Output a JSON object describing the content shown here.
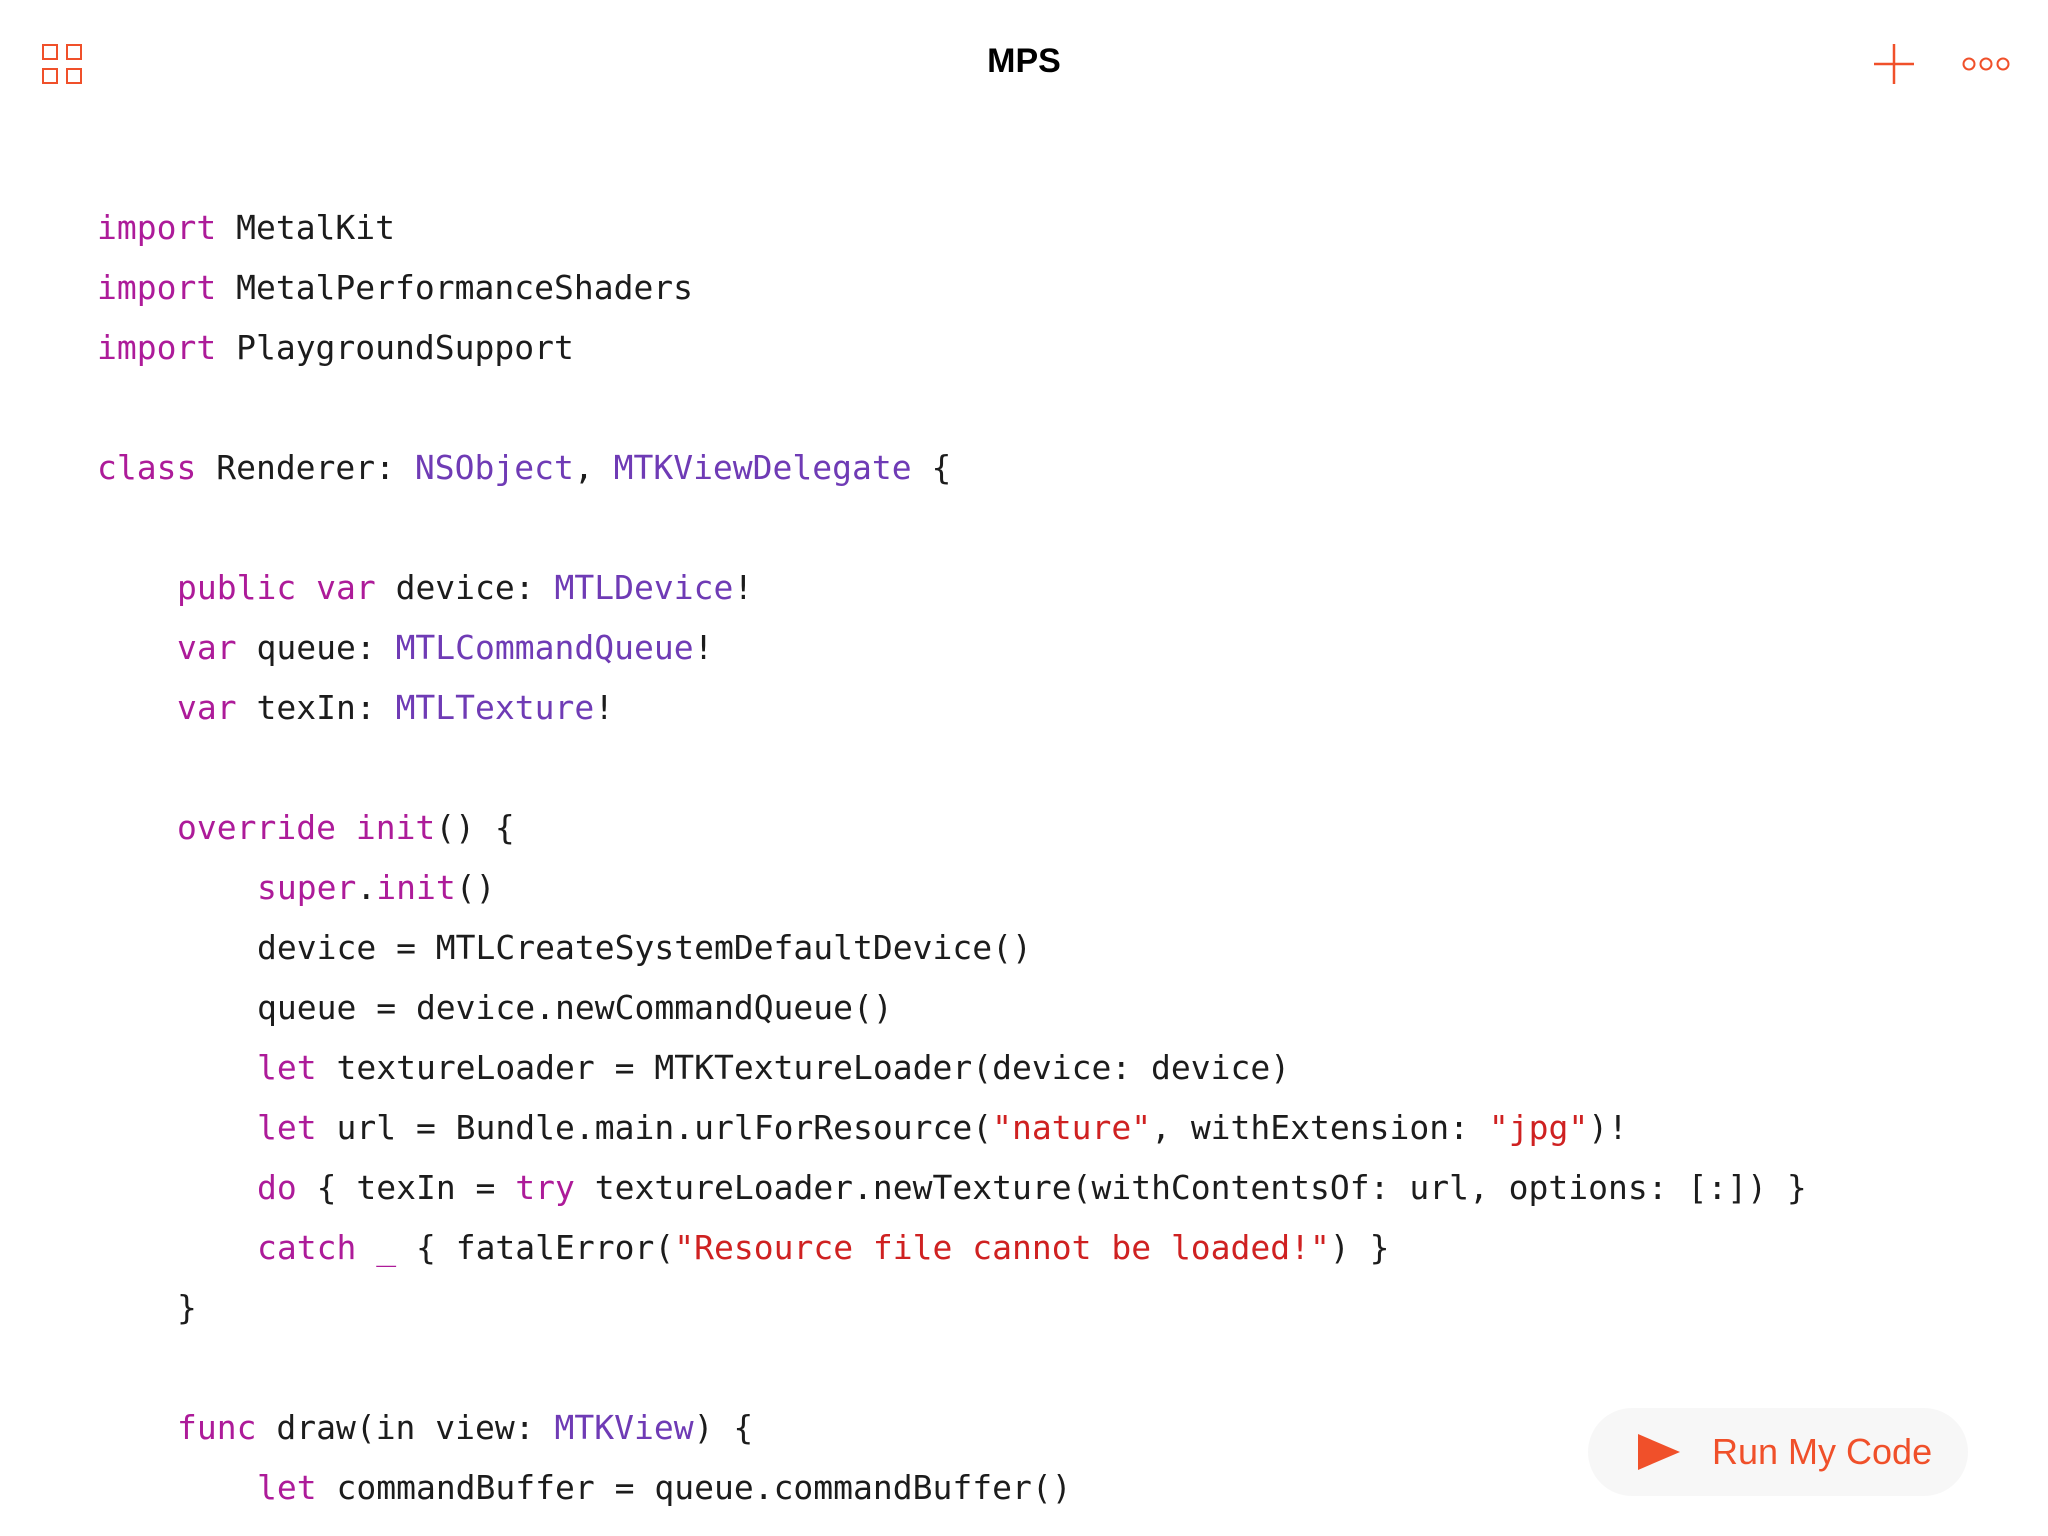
{
  "app": {
    "title": "MPS"
  },
  "toolbar": {
    "left_icon": "grid-icon",
    "right_icons": [
      "plus-icon",
      "more-icon"
    ]
  },
  "colors": {
    "accent": "#f0502a",
    "keyword": "#ad1b99",
    "type": "#6f3bb5",
    "string": "#cf2121",
    "plain": "#1c1c1c"
  },
  "code": {
    "lines": [
      {
        "indent": 0,
        "tokens": [
          {
            "t": "import",
            "c": "kw"
          },
          {
            "t": " MetalKit",
            "c": "pl"
          }
        ]
      },
      {
        "indent": 0,
        "tokens": [
          {
            "t": "import",
            "c": "kw"
          },
          {
            "t": " MetalPerformanceShaders",
            "c": "pl"
          }
        ]
      },
      {
        "indent": 0,
        "tokens": [
          {
            "t": "import",
            "c": "kw"
          },
          {
            "t": " PlaygroundSupport",
            "c": "pl"
          }
        ]
      },
      {
        "indent": 0,
        "tokens": []
      },
      {
        "indent": 0,
        "tokens": [
          {
            "t": "class",
            "c": "kw"
          },
          {
            "t": " Renderer: ",
            "c": "pl"
          },
          {
            "t": "NSObject",
            "c": "ty"
          },
          {
            "t": ", ",
            "c": "pl"
          },
          {
            "t": "MTKViewDelegate",
            "c": "ty"
          },
          {
            "t": " {",
            "c": "pl"
          }
        ]
      },
      {
        "indent": 0,
        "tokens": []
      },
      {
        "indent": 1,
        "tokens": [
          {
            "t": "public",
            "c": "kw"
          },
          {
            "t": " ",
            "c": "pl"
          },
          {
            "t": "var",
            "c": "kw"
          },
          {
            "t": " device: ",
            "c": "pl"
          },
          {
            "t": "MTLDevice",
            "c": "ty"
          },
          {
            "t": "!",
            "c": "pl"
          }
        ]
      },
      {
        "indent": 1,
        "tokens": [
          {
            "t": "var",
            "c": "kw"
          },
          {
            "t": " queue: ",
            "c": "pl"
          },
          {
            "t": "MTLCommandQueue",
            "c": "ty"
          },
          {
            "t": "!",
            "c": "pl"
          }
        ]
      },
      {
        "indent": 1,
        "tokens": [
          {
            "t": "var",
            "c": "kw"
          },
          {
            "t": " texIn: ",
            "c": "pl"
          },
          {
            "t": "MTLTexture",
            "c": "ty"
          },
          {
            "t": "!",
            "c": "pl"
          }
        ]
      },
      {
        "indent": 0,
        "tokens": []
      },
      {
        "indent": 1,
        "tokens": [
          {
            "t": "override",
            "c": "kw"
          },
          {
            "t": " ",
            "c": "pl"
          },
          {
            "t": "init",
            "c": "kw"
          },
          {
            "t": "() {",
            "c": "pl"
          }
        ]
      },
      {
        "indent": 2,
        "tokens": [
          {
            "t": "super",
            "c": "kw"
          },
          {
            "t": ".",
            "c": "pl"
          },
          {
            "t": "init",
            "c": "kw"
          },
          {
            "t": "()",
            "c": "pl"
          }
        ]
      },
      {
        "indent": 2,
        "tokens": [
          {
            "t": "device = MTLCreateSystemDefaultDevice()",
            "c": "pl"
          }
        ]
      },
      {
        "indent": 2,
        "tokens": [
          {
            "t": "queue = device.newCommandQueue()",
            "c": "pl"
          }
        ]
      },
      {
        "indent": 2,
        "tokens": [
          {
            "t": "let",
            "c": "kw"
          },
          {
            "t": " textureLoader = MTKTextureLoader(device: device)",
            "c": "pl"
          }
        ]
      },
      {
        "indent": 2,
        "tokens": [
          {
            "t": "let",
            "c": "kw"
          },
          {
            "t": " url = Bundle.main.urlForResource(",
            "c": "pl"
          },
          {
            "t": "\"nature\"",
            "c": "str"
          },
          {
            "t": ", withExtension: ",
            "c": "pl"
          },
          {
            "t": "\"jpg\"",
            "c": "str"
          },
          {
            "t": ")!",
            "c": "pl"
          }
        ]
      },
      {
        "indent": 2,
        "tokens": [
          {
            "t": "do",
            "c": "kw"
          },
          {
            "t": " { texIn = ",
            "c": "pl"
          },
          {
            "t": "try",
            "c": "kw"
          },
          {
            "t": " textureLoader.newTexture(withContentsOf: url, options: [:]) }",
            "c": "pl"
          }
        ]
      },
      {
        "indent": 2,
        "tokens": [
          {
            "t": "catch",
            "c": "kw"
          },
          {
            "t": " ",
            "c": "pl"
          },
          {
            "t": "_",
            "c": "kw"
          },
          {
            "t": " { fatalError(",
            "c": "pl"
          },
          {
            "t": "\"Resource file cannot be loaded!\"",
            "c": "str"
          },
          {
            "t": ") }",
            "c": "pl"
          }
        ]
      },
      {
        "indent": 1,
        "tokens": [
          {
            "t": "}",
            "c": "pl"
          }
        ]
      },
      {
        "indent": 0,
        "tokens": []
      },
      {
        "indent": 1,
        "tokens": [
          {
            "t": "func",
            "c": "kw"
          },
          {
            "t": " draw(in view: ",
            "c": "pl"
          },
          {
            "t": "MTKView",
            "c": "ty"
          },
          {
            "t": ") {",
            "c": "pl"
          }
        ]
      },
      {
        "indent": 2,
        "tokens": [
          {
            "t": "let",
            "c": "kw"
          },
          {
            "t": " commandBuffer = queue.commandBuffer()",
            "c": "pl"
          }
        ]
      }
    ]
  },
  "run_button": {
    "label": "Run My Code",
    "icon": "play-icon"
  }
}
